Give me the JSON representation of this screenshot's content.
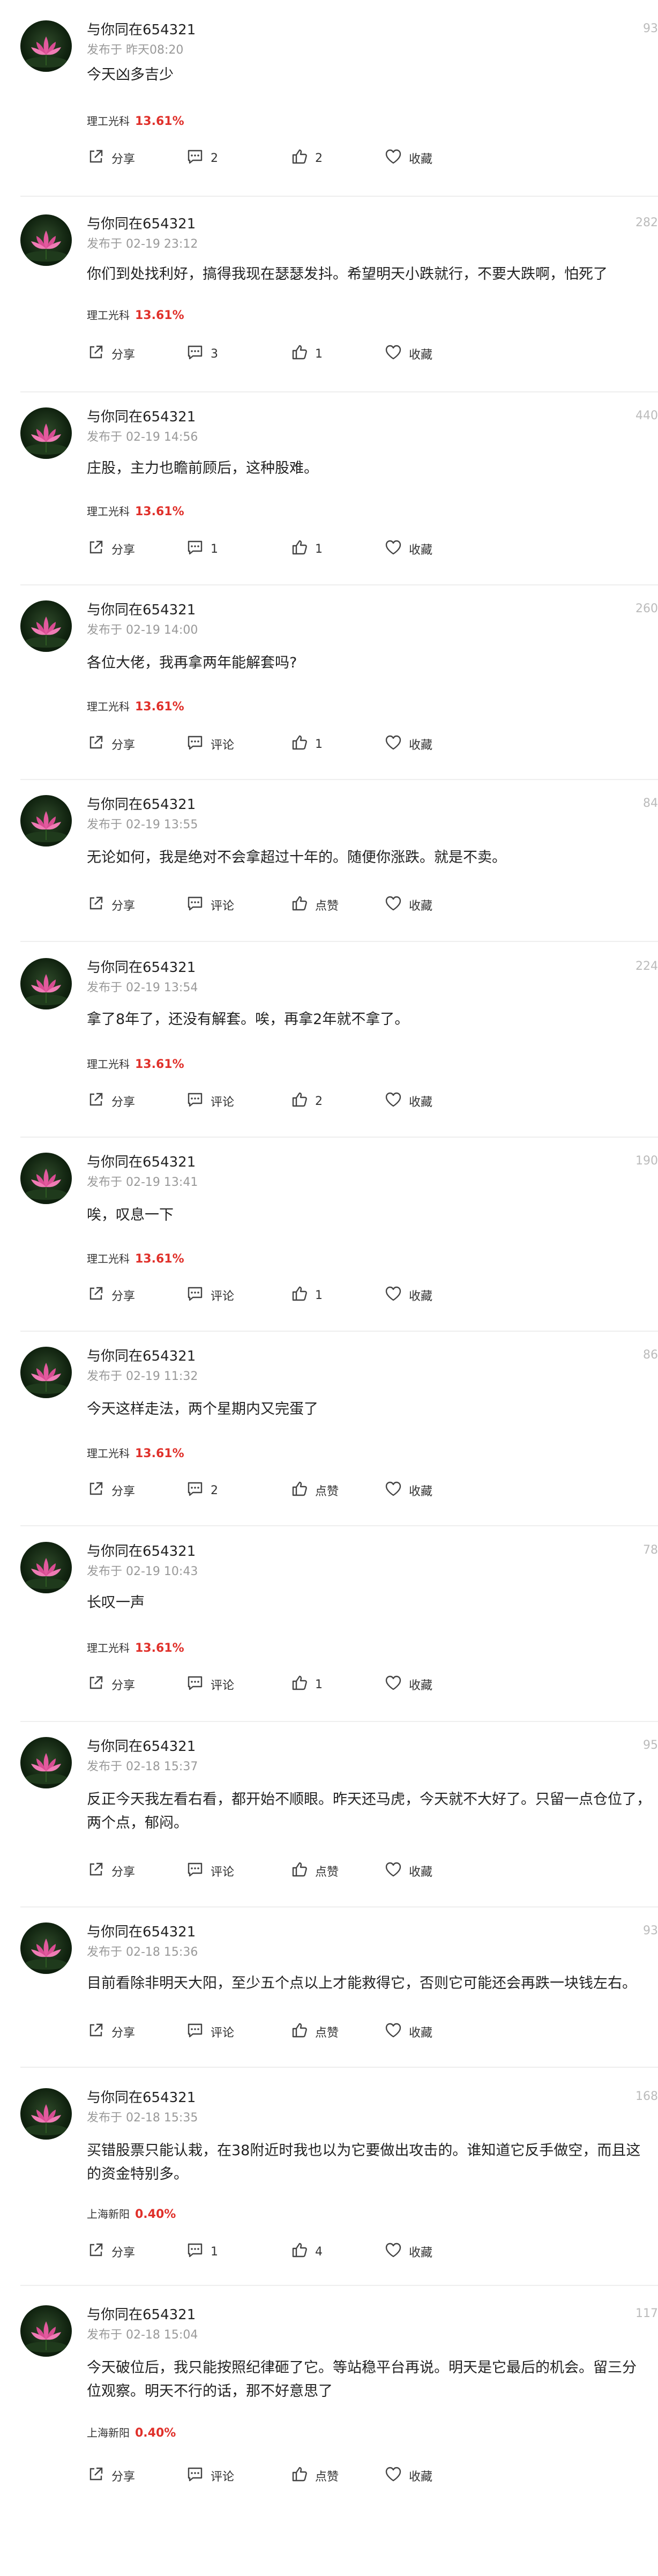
{
  "labels": {
    "share": "分享",
    "comment": "评论",
    "like": "点赞",
    "favorite": "收藏"
  },
  "posts": [
    {
      "user": "与你同在654321",
      "time": "发布于 昨天08:20",
      "views": "93",
      "content": "今天凶多吉少",
      "stock": {
        "name": "理工光科",
        "pct": "13.61%"
      },
      "share": "分享",
      "comments": "2",
      "likes": "2",
      "fav": "收藏"
    },
    {
      "user": "与你同在654321",
      "time": "发布于 02-19 23:12",
      "views": "282",
      "content": "你们到处找利好，搞得我现在瑟瑟发抖。希望明天小跌就行，不要大跌啊，怕死了",
      "stock": {
        "name": "理工光科",
        "pct": "13.61%"
      },
      "share": "分享",
      "comments": "3",
      "likes": "1",
      "fav": "收藏"
    },
    {
      "user": "与你同在654321",
      "time": "发布于 02-19 14:56",
      "views": "440",
      "content": "庄股，主力也瞻前顾后，这种股难。",
      "stock": {
        "name": "理工光科",
        "pct": "13.61%"
      },
      "share": "分享",
      "comments": "1",
      "likes": "1",
      "fav": "收藏"
    },
    {
      "user": "与你同在654321",
      "time": "发布于 02-19 14:00",
      "views": "260",
      "content": "各位大佬，我再拿两年能解套吗?",
      "stock": {
        "name": "理工光科",
        "pct": "13.61%"
      },
      "share": "分享",
      "comments": "评论",
      "likes": "1",
      "fav": "收藏"
    },
    {
      "user": "与你同在654321",
      "time": "发布于 02-19 13:55",
      "views": "84",
      "content": "无论如何，我是绝对不会拿超过十年的。随便你涨跌。就是不卖。",
      "stock": null,
      "share": "分享",
      "comments": "评论",
      "likes": "点赞",
      "fav": "收藏"
    },
    {
      "user": "与你同在654321",
      "time": "发布于 02-19 13:54",
      "views": "224",
      "content": "拿了8年了，还没有解套。唉，再拿2年就不拿了。",
      "stock": {
        "name": "理工光科",
        "pct": "13.61%"
      },
      "share": "分享",
      "comments": "评论",
      "likes": "2",
      "fav": "收藏"
    },
    {
      "user": "与你同在654321",
      "time": "发布于 02-19 13:41",
      "views": "190",
      "content": "唉，叹息一下",
      "stock": {
        "name": "理工光科",
        "pct": "13.61%"
      },
      "share": "分享",
      "comments": "评论",
      "likes": "1",
      "fav": "收藏"
    },
    {
      "user": "与你同在654321",
      "time": "发布于 02-19 11:32",
      "views": "86",
      "content": "今天这样走法，两个星期内又完蛋了",
      "stock": {
        "name": "理工光科",
        "pct": "13.61%"
      },
      "share": "分享",
      "comments": "2",
      "likes": "点赞",
      "fav": "收藏"
    },
    {
      "user": "与你同在654321",
      "time": "发布于 02-19 10:43",
      "views": "78",
      "content": "长叹一声",
      "stock": {
        "name": "理工光科",
        "pct": "13.61%"
      },
      "share": "分享",
      "comments": "评论",
      "likes": "1",
      "fav": "收藏"
    },
    {
      "user": "与你同在654321",
      "time": "发布于 02-18 15:37",
      "views": "95",
      "content": "反正今天我左看右看，都开始不顺眼。昨天还马虎，今天就不大好了。只留一点仓位了，\n两个点，郁闷。",
      "stock": null,
      "share": "分享",
      "comments": "评论",
      "likes": "点赞",
      "fav": "收藏"
    },
    {
      "user": "与你同在654321",
      "time": "发布于 02-18 15:36",
      "views": "93",
      "content": "目前看除非明天大阳，至少五个点以上才能救得它，否则它可能还会再跌一块钱左右。",
      "stock": null,
      "share": "分享",
      "comments": "评论",
      "likes": "点赞",
      "fav": "收藏"
    },
    {
      "user": "与你同在654321",
      "time": "发布于 02-18 15:35",
      "views": "168",
      "content": "买错股票只能认栽，在38附近时我也以为它要做出攻击的。谁知道它反手做空，而且这\n的资金特别多。",
      "stock": {
        "name": "上海新阳",
        "pct": "0.40%"
      },
      "share": "分享",
      "comments": "1",
      "likes": "4",
      "fav": "收藏"
    },
    {
      "user": "与你同在654321",
      "time": "发布于 02-18 15:04",
      "views": "117",
      "content": "今天破位后，我只能按照纪律砸了它。等站稳平台再说。明天是它最后的机会。留三分\n位观察。明天不行的话，那不好意思了",
      "stock": {
        "name": "上海新阳",
        "pct": "0.40%"
      },
      "share": "分享",
      "comments": "评论",
      "likes": "点赞",
      "fav": "收藏"
    }
  ]
}
